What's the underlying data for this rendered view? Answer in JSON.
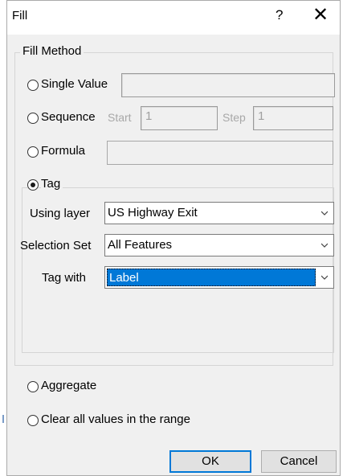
{
  "dialog": {
    "title": "Fill",
    "help_label": "?",
    "close_label": "✕"
  },
  "fill_method": {
    "group_label": "Fill Method",
    "single_value": {
      "label": "Single Value",
      "value": ""
    },
    "sequence": {
      "label": "Sequence",
      "start_label": "Start",
      "start_value": "1",
      "step_label": "Step",
      "step_value": "1"
    },
    "formula": {
      "label": "Formula",
      "value": ""
    },
    "tag": {
      "label": "Tag",
      "selected": true,
      "using_layer_label": "Using layer",
      "using_layer_value": "US Highway Exit",
      "selection_set_label": "Selection Set",
      "selection_set_value": "All Features",
      "tag_with_label": "Tag with",
      "tag_with_value": "Label"
    },
    "aggregate": {
      "label": "Aggregate"
    },
    "clear": {
      "label": "Clear all values in the range"
    }
  },
  "buttons": {
    "ok": "OK",
    "cancel": "Cancel"
  },
  "icons": {
    "dropdown": "chevron-down-icon",
    "close": "close-icon",
    "help": "help-icon"
  },
  "colors": {
    "selection": "#0078d7",
    "dialog_bg": "#f0f0f0",
    "titlebar_bg": "#ffffff"
  }
}
